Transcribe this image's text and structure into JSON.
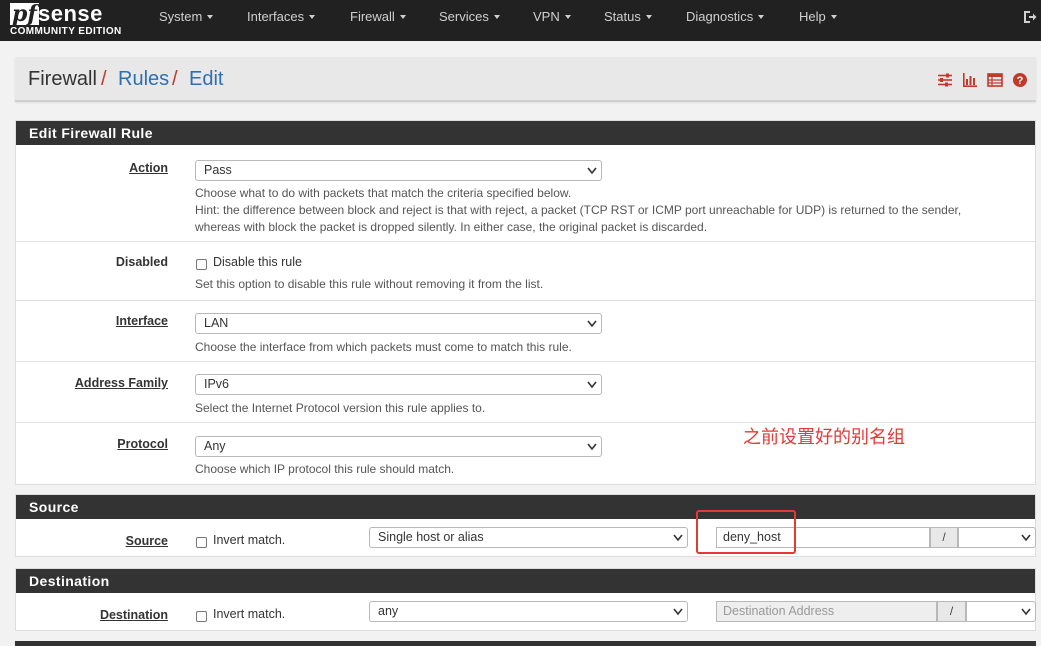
{
  "brand": {
    "pf": "pf",
    "sense": "sense",
    "edition": "COMMUNITY EDITION"
  },
  "nav": {
    "items": [
      "System",
      "Interfaces",
      "Firewall",
      "Services",
      "VPN",
      "Status",
      "Diagnostics",
      "Help"
    ],
    "logout_icon": "logout-icon"
  },
  "breadcrumb": {
    "root": "Firewall",
    "rules": "Rules",
    "edit": "Edit",
    "separator": "/"
  },
  "breadcrumb_icons": [
    "sliders-icon",
    "bar-chart-icon",
    "table-icon",
    "help-circle-icon"
  ],
  "edit_panel": {
    "title": "Edit Firewall Rule",
    "action": {
      "label": "Action",
      "value": "Pass",
      "help1": "Choose what to do with packets that match the criteria specified below.",
      "help2": "Hint: the difference between block and reject is that with reject, a packet (TCP RST or ICMP port unreachable for UDP) is returned to the sender,",
      "help3": "whereas with block the packet is dropped silently. In either case, the original packet is discarded."
    },
    "disabled": {
      "label": "Disabled",
      "checkbox_text": "Disable this rule",
      "help": "Set this option to disable this rule without removing it from the list."
    },
    "interface": {
      "label": "Interface",
      "value": "LAN",
      "help": "Choose the interface from which packets must come to match this rule."
    },
    "address_family": {
      "label": "Address Family",
      "value": "IPv6",
      "help": "Select the Internet Protocol version this rule applies to."
    },
    "protocol": {
      "label": "Protocol",
      "value": "Any",
      "help": "Choose which IP protocol this rule should match."
    }
  },
  "source_panel": {
    "title": "Source",
    "label": "Source",
    "invert_text": "Invert match.",
    "type_value": "Single host or alias",
    "address_value": "deny_host",
    "mask_separator": "/",
    "mask_value": ""
  },
  "destination_panel": {
    "title": "Destination",
    "label": "Destination",
    "invert_text": "Invert match.",
    "type_value": "any",
    "address_placeholder": "Destination Address",
    "mask_separator": "/",
    "mask_value": ""
  },
  "annotation": {
    "text": "之前设置好的别名组",
    "color": "#e53935"
  },
  "colors": {
    "navbar": "#212121",
    "panel_heading": "#333333",
    "link": "#2f6fb1",
    "accent_red": "#c0392b"
  }
}
